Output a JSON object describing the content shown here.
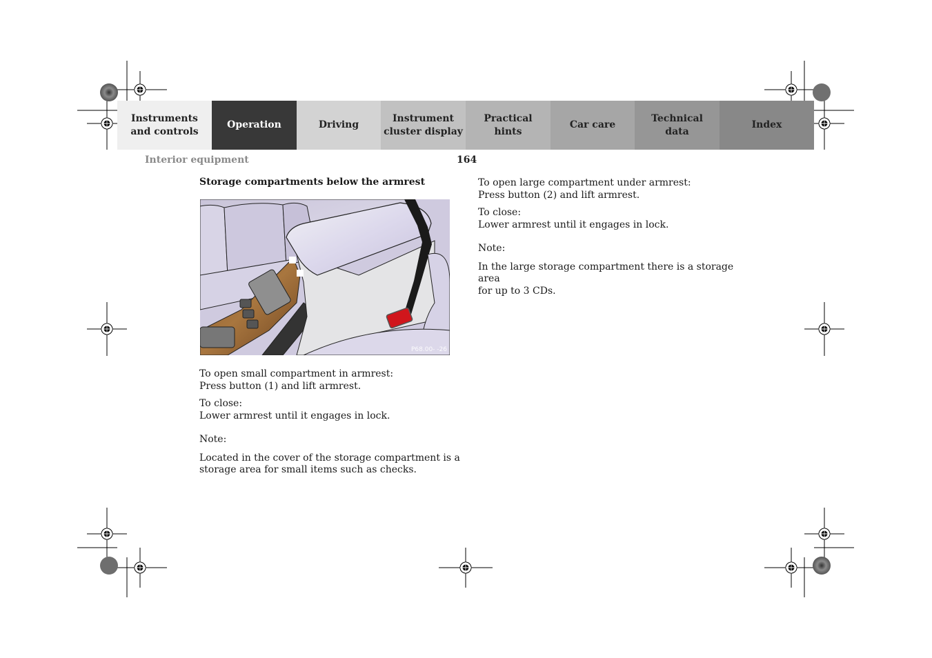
{
  "nav": {
    "tabs": [
      {
        "label": "Instruments\nand controls",
        "line1": "Instruments",
        "line2": "and controls",
        "color": "#efefef",
        "active": false
      },
      {
        "label": "Operation",
        "line1": "Operation",
        "line2": "",
        "color": "#383838",
        "active": true
      },
      {
        "label": "Driving",
        "line1": "Driving",
        "line2": "",
        "color": "#d3d3d3",
        "active": false
      },
      {
        "label": "Instrument\ncluster display",
        "line1": "Instrument",
        "line2": "cluster display",
        "color": "#c1c1c1",
        "active": false
      },
      {
        "label": "Practical hints",
        "line1": "Practical hints",
        "line2": "",
        "color": "#b4b4b4",
        "active": false
      },
      {
        "label": "Car care",
        "line1": "Car care",
        "line2": "",
        "color": "#a6a6a6",
        "active": false
      },
      {
        "label": "Technical\ndata",
        "line1": "Technical",
        "line2": "data",
        "color": "#969696",
        "active": false
      },
      {
        "label": "Index",
        "line1": "Index",
        "line2": "",
        "color": "#888888",
        "active": false
      }
    ]
  },
  "header": {
    "section": "Interior equipment",
    "page_number": "164"
  },
  "content": {
    "heading": "Storage compartments below the armrest",
    "figure": {
      "code": "P68.00-   -26",
      "description": "Illustration of center console armrest with storage compartments, wood trim, switches and red seat belt buckle"
    },
    "left": {
      "open_label": "To open small compartment in armrest:",
      "open_text": "Press button (1) and lift armrest.",
      "close_label": "To close:",
      "close_text": "Lower armrest until it engages in lock.",
      "note_label": "Note:",
      "note_line1": "Located in the cover of the storage compartment is a",
      "note_line2": "storage area for small items such as checks."
    },
    "right": {
      "open_label": "To open large compartment under armrest:",
      "open_text": "Press button (2) and lift armrest.",
      "close_label": "To close:",
      "close_text": "Lower armrest until it engages in lock.",
      "note_label": "Note:",
      "note_line1": "In the large storage compartment there is a storage area",
      "note_line2": "for up to 3 CDs."
    }
  }
}
